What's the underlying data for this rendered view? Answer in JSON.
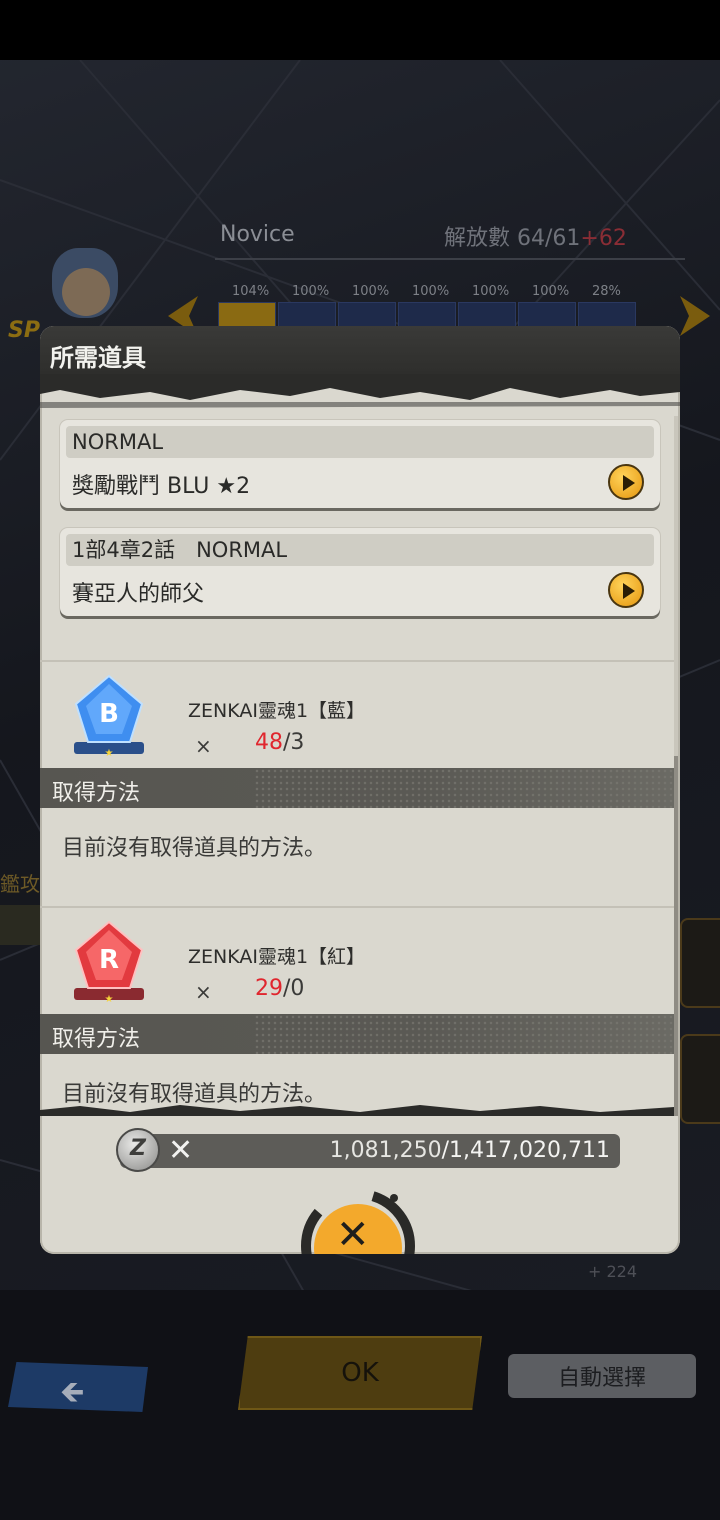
{
  "background": {
    "rank": "Novice",
    "release_label": "解放數 64/61",
    "release_plus": "+62",
    "percents": [
      "104%",
      "100%",
      "100%",
      "100%",
      "100%",
      "100%",
      "28%"
    ],
    "side_label": "鑑攻擊",
    "plus_count": "+ 224",
    "ok_label": "OK",
    "auto_select_label": "自動選擇",
    "sp_badge": "SP"
  },
  "modal": {
    "title": "所需道具",
    "stages": [
      {
        "header": "NORMAL",
        "name": "獎勵戰鬥 BLU ★2"
      },
      {
        "header": "1部4章2話　NORMAL",
        "name": "賽亞人的師父"
      }
    ],
    "items": [
      {
        "name": "ZENKAI靈魂1【藍】",
        "times": "×",
        "have": "48",
        "need": "/3",
        "method_label": "取得方法",
        "method_text": "目前沒有取得道具的方法。",
        "color": "#2f7fe8"
      },
      {
        "name": "ZENKAI靈魂1【紅】",
        "times": "×",
        "have": "29",
        "need": "/0",
        "method_label": "取得方法",
        "method_text": "目前沒有取得道具的方法。",
        "color": "#e2303a"
      }
    ],
    "coins": {
      "times": "✕",
      "cost": "1,081,250",
      "owned": "/1,417,020,711"
    },
    "close_icon": "close-icon"
  },
  "colors": {
    "accent_orange": "#f3a92c",
    "count_red": "#e0262e",
    "panel_bg": "#dad8cf"
  }
}
